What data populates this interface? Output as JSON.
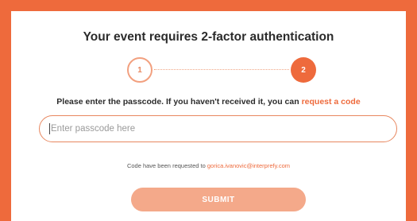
{
  "dialog": {
    "title": "Your event requires 2-factor authentication"
  },
  "stepper": {
    "steps": [
      {
        "label": "1",
        "state": "pending"
      },
      {
        "label": "2",
        "state": "active"
      }
    ]
  },
  "instruction": {
    "text": "Please enter the passcode. If you haven't received it, you can",
    "link_label": "request a code"
  },
  "passcode": {
    "placeholder": "Enter passcode here",
    "value": ""
  },
  "notice": {
    "text": "Code have been requested to",
    "email": "gorica.ivanovic@interprefy.com"
  },
  "submit": {
    "label": "SUBMIT"
  },
  "colors": {
    "accent": "#ee6a3c",
    "button": "#f4a98a",
    "outline": "#e8875f"
  }
}
